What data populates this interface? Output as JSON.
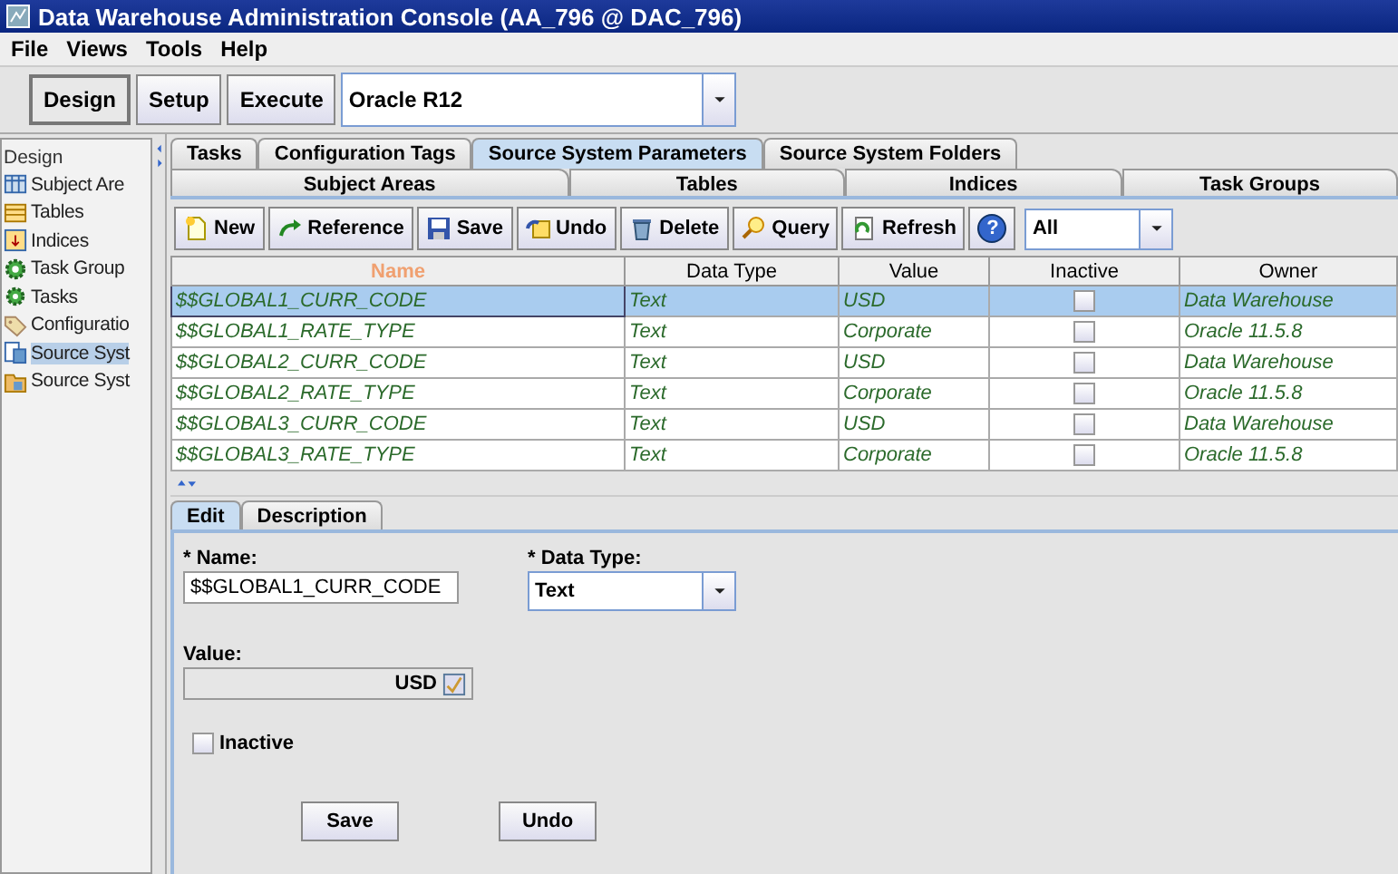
{
  "window": {
    "title": "Data Warehouse Administration Console (AA_796 @ DAC_796)"
  },
  "menu": [
    "File",
    "Views",
    "Tools",
    "Help"
  ],
  "mode_buttons": [
    {
      "label": "Design",
      "selected": true
    },
    {
      "label": "Setup",
      "selected": false
    },
    {
      "label": "Execute",
      "selected": false
    }
  ],
  "container_select": {
    "value": "Oracle R12"
  },
  "sidebar": {
    "title": "Design",
    "items": [
      {
        "label": "Subject Are",
        "kind": "grid",
        "selected": false
      },
      {
        "label": "Tables",
        "kind": "table",
        "selected": false
      },
      {
        "label": "Indices",
        "kind": "index",
        "selected": false
      },
      {
        "label": "Task Group",
        "kind": "gears",
        "selected": false
      },
      {
        "label": "Tasks",
        "kind": "gear",
        "selected": false
      },
      {
        "label": "Configuratio",
        "kind": "tag",
        "selected": false
      },
      {
        "label": "Source Syst",
        "kind": "params",
        "selected": true
      },
      {
        "label": "Source Syst",
        "kind": "folder",
        "selected": false
      }
    ]
  },
  "tabs": [
    {
      "label": "Tasks",
      "selected": false
    },
    {
      "label": "Configuration Tags",
      "selected": false
    },
    {
      "label": "Source System Parameters",
      "selected": true
    },
    {
      "label": "Source System Folders",
      "selected": false
    }
  ],
  "subtabs": [
    {
      "label": "Subject Areas",
      "selected": false
    },
    {
      "label": "Tables",
      "selected": false
    },
    {
      "label": "Indices",
      "selected": false
    },
    {
      "label": "Task Groups",
      "selected": false
    }
  ],
  "toolbar": [
    {
      "kind": "new",
      "label": "New"
    },
    {
      "kind": "reference",
      "label": "Reference"
    },
    {
      "kind": "save",
      "label": "Save"
    },
    {
      "kind": "undo",
      "label": "Undo"
    },
    {
      "kind": "delete",
      "label": "Delete"
    },
    {
      "kind": "query",
      "label": "Query"
    },
    {
      "kind": "refresh",
      "label": "Refresh"
    },
    {
      "kind": "help",
      "label": "?"
    }
  ],
  "filter_select": {
    "value": "All"
  },
  "table": {
    "columns": [
      "Name",
      "Data Type",
      "Value",
      "Inactive",
      "Owner"
    ],
    "rows": [
      {
        "name": "$$GLOBAL1_CURR_CODE",
        "data_type": "Text",
        "value": "USD",
        "inactive": false,
        "owner": "Data Warehouse",
        "selected": true
      },
      {
        "name": "$$GLOBAL1_RATE_TYPE",
        "data_type": "Text",
        "value": "Corporate",
        "inactive": false,
        "owner": "Oracle 11.5.8",
        "selected": false
      },
      {
        "name": "$$GLOBAL2_CURR_CODE",
        "data_type": "Text",
        "value": "USD",
        "inactive": false,
        "owner": "Data Warehouse",
        "selected": false
      },
      {
        "name": "$$GLOBAL2_RATE_TYPE",
        "data_type": "Text",
        "value": "Corporate",
        "inactive": false,
        "owner": "Oracle 11.5.8",
        "selected": false
      },
      {
        "name": "$$GLOBAL3_CURR_CODE",
        "data_type": "Text",
        "value": "USD",
        "inactive": false,
        "owner": "Data Warehouse",
        "selected": false
      },
      {
        "name": "$$GLOBAL3_RATE_TYPE",
        "data_type": "Text",
        "value": "Corporate",
        "inactive": false,
        "owner": "Oracle 11.5.8",
        "selected": false
      }
    ]
  },
  "detail_tabs": [
    {
      "label": "Edit",
      "selected": true
    },
    {
      "label": "Description",
      "selected": false
    }
  ],
  "form": {
    "name_label": "* Name:",
    "name_value": "$$GLOBAL1_CURR_CODE",
    "data_type_label": "* Data Type:",
    "data_type_value": "Text",
    "value_label": "Value:",
    "value": "USD",
    "inactive_label": "Inactive",
    "inactive": false,
    "buttons": [
      "Save",
      "Undo"
    ]
  }
}
